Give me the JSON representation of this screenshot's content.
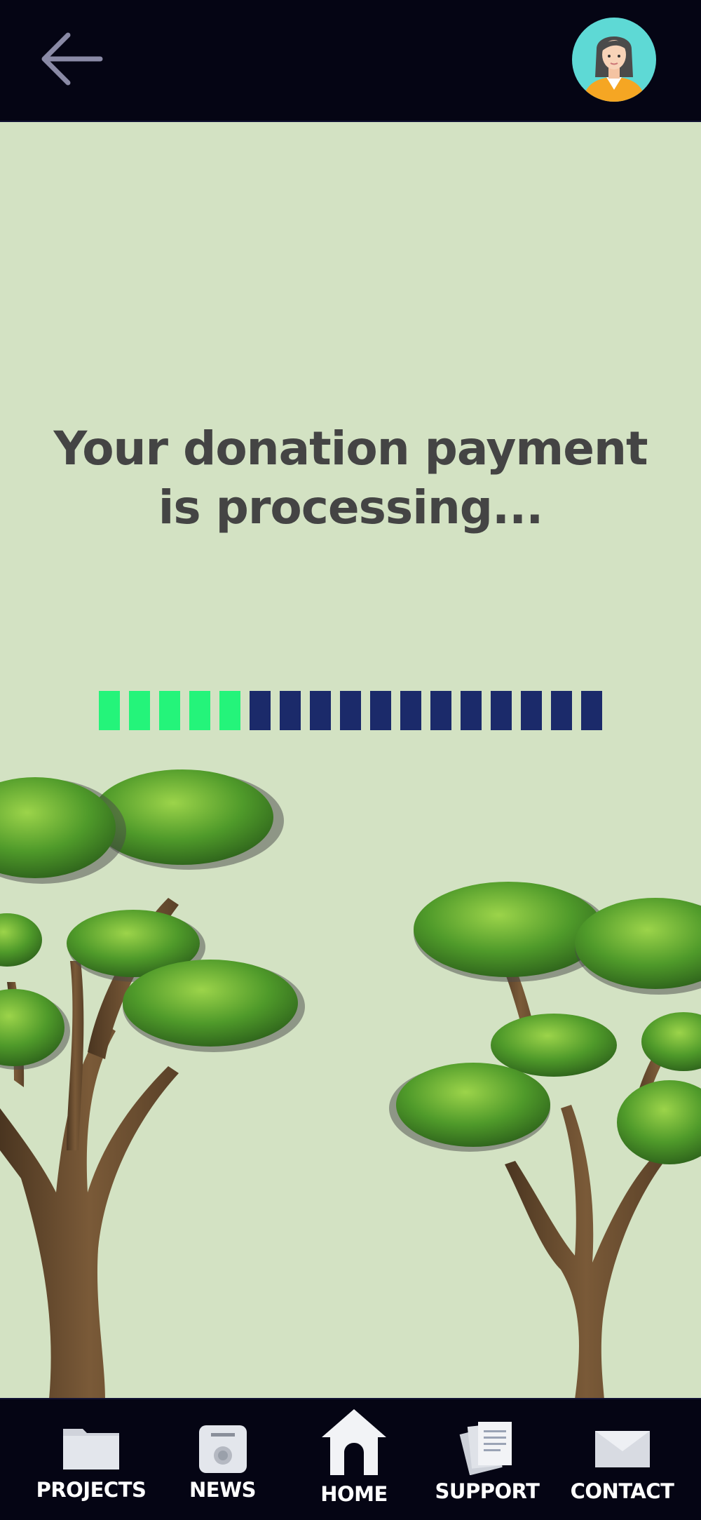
{
  "header": {
    "back_icon": "arrow-left-icon",
    "avatar_icon": "user-avatar-icon"
  },
  "main": {
    "message": "Your donation payment is processing...",
    "progress": {
      "completed_segments": 5,
      "total_segments": 17,
      "completed_color": "#24f47a",
      "pending_color": "#1b2a6a"
    }
  },
  "colors": {
    "background": "#d3e2c3",
    "bars": "#050514",
    "text": "#444444"
  },
  "nav": {
    "items": [
      {
        "label": "PROJECTS",
        "icon": "folder-icon"
      },
      {
        "label": "NEWS",
        "icon": "news-icon"
      },
      {
        "label": "HOME",
        "icon": "home-icon",
        "active": true
      },
      {
        "label": "SUPPORT",
        "icon": "documents-icon"
      },
      {
        "label": "CONTACT",
        "icon": "envelope-icon"
      }
    ]
  }
}
